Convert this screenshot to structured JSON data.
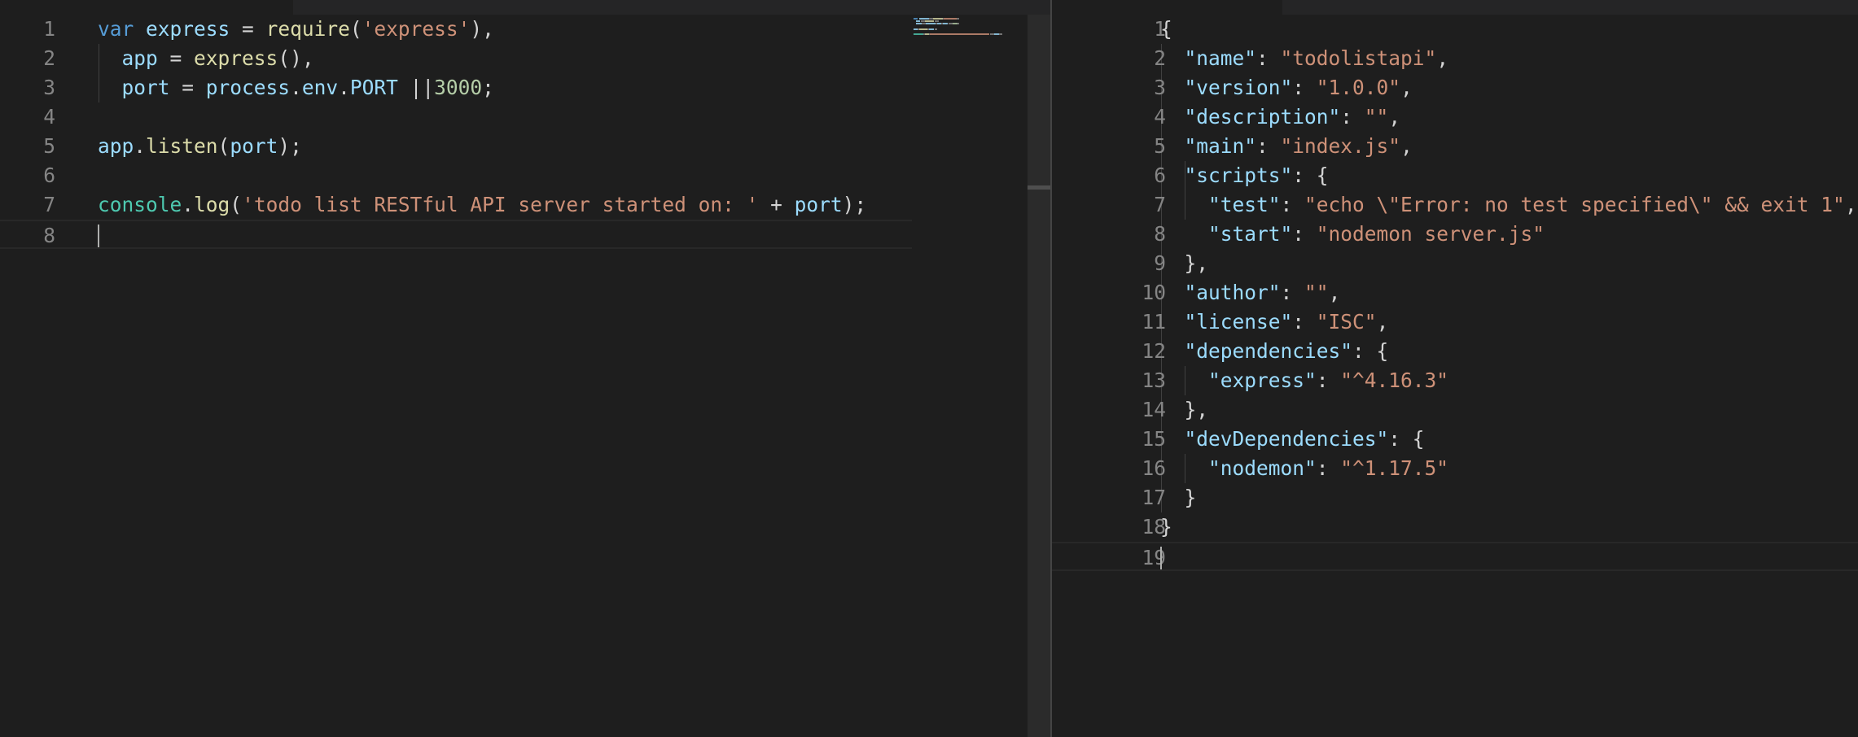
{
  "left_editor": {
    "lines": [
      {
        "number": "1",
        "tokens": [
          {
            "t": "var",
            "c": "kw"
          },
          {
            "t": " ",
            "c": "pun"
          },
          {
            "t": "express",
            "c": "var"
          },
          {
            "t": " = ",
            "c": "pun"
          },
          {
            "t": "require",
            "c": "fn"
          },
          {
            "t": "(",
            "c": "pun"
          },
          {
            "t": "'express'",
            "c": "str"
          },
          {
            "t": "),",
            "c": "pun"
          }
        ]
      },
      {
        "number": "2",
        "tokens": [
          {
            "t": "  ",
            "c": "pun"
          },
          {
            "t": "app",
            "c": "var"
          },
          {
            "t": " = ",
            "c": "pun"
          },
          {
            "t": "express",
            "c": "fn"
          },
          {
            "t": "(),",
            "c": "pun"
          }
        ]
      },
      {
        "number": "3",
        "tokens": [
          {
            "t": "  ",
            "c": "pun"
          },
          {
            "t": "port",
            "c": "var"
          },
          {
            "t": " = ",
            "c": "pun"
          },
          {
            "t": "process",
            "c": "var"
          },
          {
            "t": ".",
            "c": "pun"
          },
          {
            "t": "env",
            "c": "var"
          },
          {
            "t": ".",
            "c": "pun"
          },
          {
            "t": "PORT",
            "c": "var"
          },
          {
            "t": " ||",
            "c": "pun"
          },
          {
            "t": "3000",
            "c": "num"
          },
          {
            "t": ";",
            "c": "pun"
          }
        ]
      },
      {
        "number": "4",
        "tokens": []
      },
      {
        "number": "5",
        "tokens": [
          {
            "t": "app",
            "c": "var"
          },
          {
            "t": ".",
            "c": "pun"
          },
          {
            "t": "listen",
            "c": "fn"
          },
          {
            "t": "(",
            "c": "pun"
          },
          {
            "t": "port",
            "c": "var"
          },
          {
            "t": ");",
            "c": "pun"
          }
        ]
      },
      {
        "number": "6",
        "tokens": []
      },
      {
        "number": "7",
        "tokens": [
          {
            "t": "console",
            "c": "type"
          },
          {
            "t": ".",
            "c": "pun"
          },
          {
            "t": "log",
            "c": "fn"
          },
          {
            "t": "(",
            "c": "pun"
          },
          {
            "t": "'todo list RESTful API server started on: '",
            "c": "str"
          },
          {
            "t": " + ",
            "c": "pun"
          },
          {
            "t": "port",
            "c": "var"
          },
          {
            "t": ");",
            "c": "pun"
          }
        ]
      },
      {
        "number": "8",
        "tokens": []
      }
    ]
  },
  "right_editor": {
    "lines": [
      {
        "number": "1",
        "tokens": [
          {
            "t": "{",
            "c": "pun"
          }
        ]
      },
      {
        "number": "2",
        "tokens": [
          {
            "t": "  ",
            "c": "pun"
          },
          {
            "t": "\"name\"",
            "c": "key"
          },
          {
            "t": ": ",
            "c": "pun"
          },
          {
            "t": "\"todolistapi\"",
            "c": "str"
          },
          {
            "t": ",",
            "c": "pun"
          }
        ]
      },
      {
        "number": "3",
        "tokens": [
          {
            "t": "  ",
            "c": "pun"
          },
          {
            "t": "\"version\"",
            "c": "key"
          },
          {
            "t": ": ",
            "c": "pun"
          },
          {
            "t": "\"1.0.0\"",
            "c": "str"
          },
          {
            "t": ",",
            "c": "pun"
          }
        ]
      },
      {
        "number": "4",
        "tokens": [
          {
            "t": "  ",
            "c": "pun"
          },
          {
            "t": "\"description\"",
            "c": "key"
          },
          {
            "t": ": ",
            "c": "pun"
          },
          {
            "t": "\"\"",
            "c": "str"
          },
          {
            "t": ",",
            "c": "pun"
          }
        ]
      },
      {
        "number": "5",
        "tokens": [
          {
            "t": "  ",
            "c": "pun"
          },
          {
            "t": "\"main\"",
            "c": "key"
          },
          {
            "t": ": ",
            "c": "pun"
          },
          {
            "t": "\"index.js\"",
            "c": "str"
          },
          {
            "t": ",",
            "c": "pun"
          }
        ]
      },
      {
        "number": "6",
        "tokens": [
          {
            "t": "  ",
            "c": "pun"
          },
          {
            "t": "\"scripts\"",
            "c": "key"
          },
          {
            "t": ": {",
            "c": "pun"
          }
        ]
      },
      {
        "number": "7",
        "tokens": [
          {
            "t": "    ",
            "c": "pun"
          },
          {
            "t": "\"test\"",
            "c": "key"
          },
          {
            "t": ": ",
            "c": "pun"
          },
          {
            "t": "\"echo \\\"Error: no test specified\\\" && exit 1\"",
            "c": "str"
          },
          {
            "t": ",",
            "c": "pun"
          }
        ]
      },
      {
        "number": "8",
        "tokens": [
          {
            "t": "    ",
            "c": "pun"
          },
          {
            "t": "\"start\"",
            "c": "key"
          },
          {
            "t": ": ",
            "c": "pun"
          },
          {
            "t": "\"nodemon server.js\"",
            "c": "str"
          }
        ]
      },
      {
        "number": "9",
        "tokens": [
          {
            "t": "  },",
            "c": "pun"
          }
        ]
      },
      {
        "number": "10",
        "tokens": [
          {
            "t": "  ",
            "c": "pun"
          },
          {
            "t": "\"author\"",
            "c": "key"
          },
          {
            "t": ": ",
            "c": "pun"
          },
          {
            "t": "\"\"",
            "c": "str"
          },
          {
            "t": ",",
            "c": "pun"
          }
        ]
      },
      {
        "number": "11",
        "tokens": [
          {
            "t": "  ",
            "c": "pun"
          },
          {
            "t": "\"license\"",
            "c": "key"
          },
          {
            "t": ": ",
            "c": "pun"
          },
          {
            "t": "\"ISC\"",
            "c": "str"
          },
          {
            "t": ",",
            "c": "pun"
          }
        ]
      },
      {
        "number": "12",
        "tokens": [
          {
            "t": "  ",
            "c": "pun"
          },
          {
            "t": "\"dependencies\"",
            "c": "key"
          },
          {
            "t": ": {",
            "c": "pun"
          }
        ]
      },
      {
        "number": "13",
        "tokens": [
          {
            "t": "    ",
            "c": "pun"
          },
          {
            "t": "\"express\"",
            "c": "key"
          },
          {
            "t": ": ",
            "c": "pun"
          },
          {
            "t": "\"^4.16.3\"",
            "c": "str"
          }
        ]
      },
      {
        "number": "14",
        "tokens": [
          {
            "t": "  },",
            "c": "pun"
          }
        ]
      },
      {
        "number": "15",
        "tokens": [
          {
            "t": "  ",
            "c": "pun"
          },
          {
            "t": "\"devDependencies\"",
            "c": "key"
          },
          {
            "t": ": {",
            "c": "pun"
          }
        ]
      },
      {
        "number": "16",
        "tokens": [
          {
            "t": "    ",
            "c": "pun"
          },
          {
            "t": "\"nodemon\"",
            "c": "key"
          },
          {
            "t": ": ",
            "c": "pun"
          },
          {
            "t": "\"^1.17.5\"",
            "c": "str"
          }
        ]
      },
      {
        "number": "17",
        "tokens": [
          {
            "t": "  }",
            "c": "pun"
          }
        ]
      },
      {
        "number": "18",
        "tokens": [
          {
            "t": "}",
            "c": "pun"
          }
        ]
      },
      {
        "number": "19",
        "tokens": []
      }
    ]
  },
  "colors": {
    "background": "#1e1e1e",
    "keyword": "#569cd6",
    "variable": "#9cdcfe",
    "function": "#dcdcaa",
    "string": "#ce9178",
    "number": "#b5cea8",
    "type": "#4ec9b0",
    "punctuation": "#d4d4d4",
    "line_number": "#858585"
  }
}
